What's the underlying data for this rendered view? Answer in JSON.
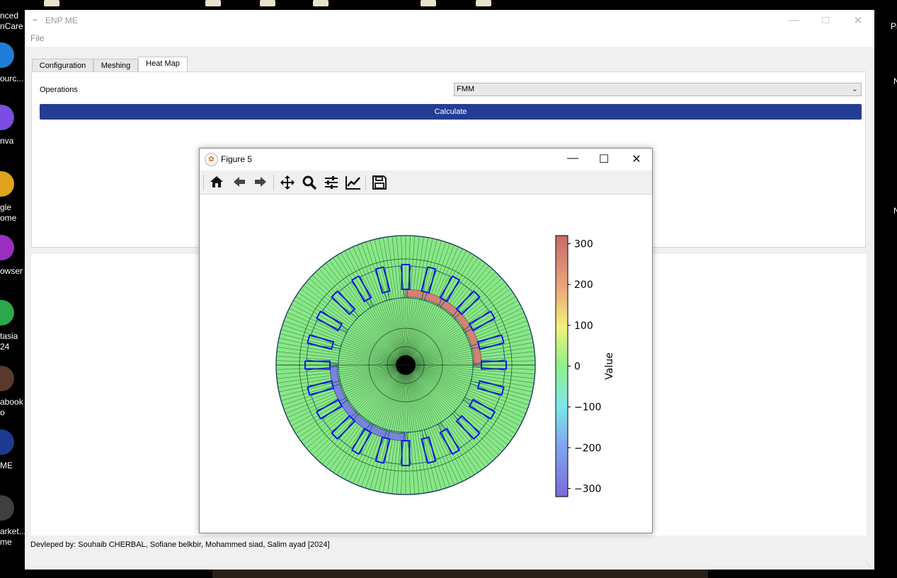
{
  "desktop": {
    "icons": [
      {
        "label": "nced\nnCare",
        "color": "#1a1a1a"
      },
      {
        "label": "ourc...",
        "color": "#1f7fd8"
      },
      {
        "label": "nva",
        "color": "#7b4de0"
      },
      {
        "label": "gle\nome",
        "color": "#e0a41c"
      },
      {
        "label": "owser",
        "color": "#9b2fc2"
      },
      {
        "label": "tasia\n24",
        "color": "#2aa84a"
      },
      {
        "label": "abook\no",
        "color": "#5a3a2a"
      },
      {
        "label": "ME",
        "color": "#1c3b8f"
      },
      {
        "label": "arket...\nme",
        "color": "#404040"
      }
    ],
    "right_labels": [
      "Pr",
      "N",
      "N"
    ]
  },
  "app": {
    "title": "ENP ME",
    "menu_file": "File",
    "tabs": {
      "configuration": "Configuration",
      "meshing": "Meshing",
      "heat_map": "Heat Map"
    },
    "operations_label": "Operations",
    "operations_value": "FMM",
    "calculate_label": "Calculate",
    "footer": "Devleped by: Souhaib CHERBAL, Sofiane belkbir, Mohammed siad, Salim ayad [2024]"
  },
  "figure": {
    "title": "Figure 5",
    "toolbar": [
      "home-icon",
      "back-icon",
      "forward-icon",
      "pan-icon",
      "zoom-icon",
      "configure-subplots-icon",
      "edit-axis-icon",
      "save-icon"
    ]
  },
  "chart_data": {
    "type": "heatmap",
    "colorbar_label": "Value",
    "colorbar_ticks": [
      300,
      200,
      100,
      0,
      -100,
      -200,
      -300
    ],
    "colorbar_range": [
      -320,
      320
    ],
    "colormap": "jet",
    "colors": {
      "background_field": "#88e888",
      "positive_band": "#d87a74",
      "negative_band": "#7a7ae8",
      "slot_outline": "#0000ff"
    },
    "rings": {
      "outer_slots": 24,
      "inner_slots": 24
    },
    "hot_band": {
      "value": 320,
      "from_angle_deg": 0,
      "to_angle_deg": 90
    },
    "cold_band": {
      "value": -320,
      "from_angle_deg": 180,
      "to_angle_deg": 270
    }
  }
}
